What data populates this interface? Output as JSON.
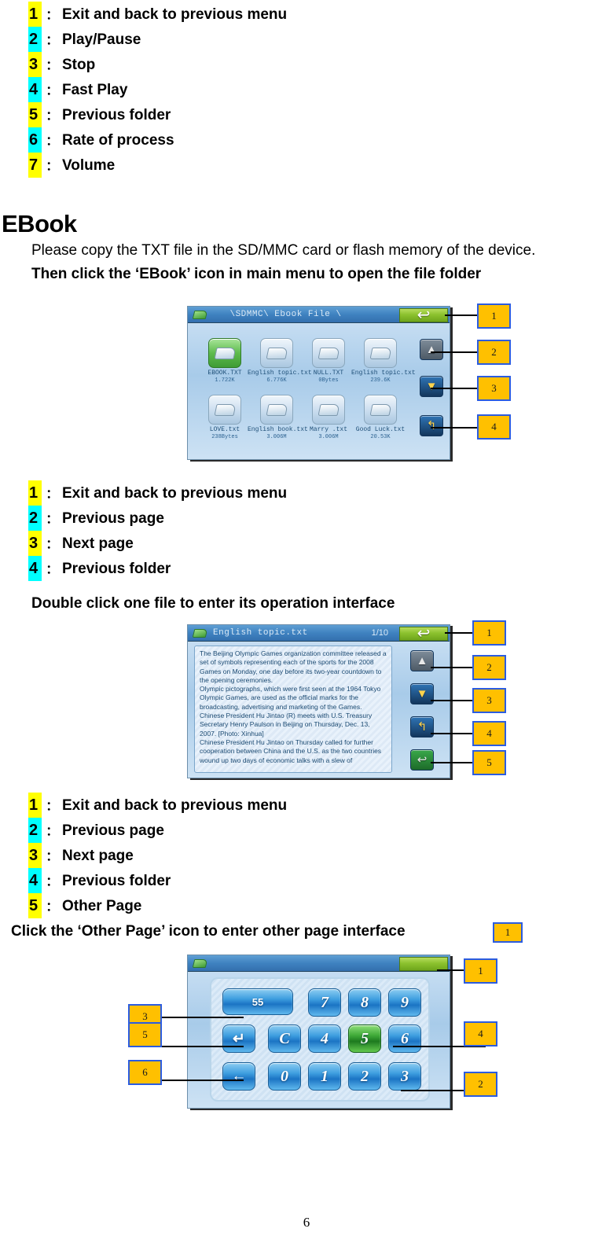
{
  "music_legend": [
    {
      "num": "1",
      "hl": "yellow",
      "label": "Exit and back to previous menu"
    },
    {
      "num": "2",
      "hl": "cyan",
      "label": "Play/Pause"
    },
    {
      "num": "3",
      "hl": "yellow",
      "label": "Stop"
    },
    {
      "num": "4",
      "hl": "cyan",
      "label": "Fast Play"
    },
    {
      "num": "5",
      "hl": "yellow",
      "label": "Previous folder"
    },
    {
      "num": "6",
      "hl": "cyan",
      "label": "Rate of process"
    },
    {
      "num": "7",
      "hl": "yellow",
      "label": "Volume"
    }
  ],
  "ebook": {
    "heading": "EBook",
    "intro": "Please copy the TXT file in the SD/MMC card or flash memory of the device.",
    "instruction": "Then click the ‘EBook’ icon in main menu to open the file folder"
  },
  "filebrowser": {
    "path": "\\SDMMC\\ Ebook File  \\",
    "back_glyph": "↩",
    "side_buttons": [
      {
        "name": "page-up",
        "glyph": "▲",
        "style": "grey"
      },
      {
        "name": "page-down",
        "glyph": "▼",
        "style": "blue"
      },
      {
        "name": "previous-folder",
        "glyph": "↰",
        "style": "blue"
      }
    ],
    "files": [
      {
        "name": "EBOOK.TXT",
        "size": "1.722K",
        "selected": true
      },
      {
        "name": "English topic.txt",
        "size": "6.776K",
        "selected": false
      },
      {
        "name": "NULL.TXT",
        "size": "0Bytes",
        "selected": false
      },
      {
        "name": "English topic.txt",
        "size": "239.6K",
        "selected": false
      },
      {
        "name": "LOVE.txt",
        "size": "238Bytes",
        "selected": false
      },
      {
        "name": "English book.txt",
        "size": "3.006M",
        "selected": false
      },
      {
        "name": "Marry .txt",
        "size": "3.006M",
        "selected": false
      },
      {
        "name": "Good Luck.txt",
        "size": "20.53K",
        "selected": false
      }
    ],
    "callouts": [
      "1",
      "2",
      "3",
      "4"
    ]
  },
  "filebrowser_legend": [
    {
      "num": "1",
      "hl": "yellow",
      "label": "Exit and back to previous menu"
    },
    {
      "num": "2",
      "hl": "cyan",
      "label": "Previous page"
    },
    {
      "num": "3",
      "hl": "yellow",
      "label": "Next page"
    },
    {
      "num": "4",
      "hl": "cyan",
      "label": "Previous folder"
    }
  ],
  "reader_instruction": "Double click one file to enter its operation interface",
  "reader": {
    "title": "English topic.txt",
    "page_indicator": "1/10",
    "back_glyph": "↩",
    "side_buttons": [
      {
        "name": "previous-page",
        "glyph": "▲",
        "style": "grey"
      },
      {
        "name": "next-page",
        "glyph": "▼",
        "style": "blue"
      },
      {
        "name": "previous-folder",
        "glyph": "↰",
        "style": "blue"
      },
      {
        "name": "other-page",
        "glyph": "↩",
        "style": "green"
      }
    ],
    "text_lines": [
      "The Beijing Olympic Games organization committee released a",
      "set of symbols representing each of the sports for the 2008",
      "Games on Monday, one day before its two-year countdown to",
      "the opening ceremonies.",
      "Olympic pictographs, which were first seen at the 1964 Tokyo",
      "Olympic Games, are used as the official marks for the",
      "broadcasting, advertising and marketing of the Games.",
      "Chinese President Hu Jintao (R) meets with U.S. Treasury",
      "Secretary Henry Paulson in Beijing on Thursday, Dec. 13,",
      "2007.  [Photo: Xinhua]",
      "Chinese President Hu Jintao on Thursday called for further",
      "cooperation between China and the U.S. as the two countries",
      "wound up two days of economic talks with a slew of"
    ],
    "callouts": [
      "1",
      "2",
      "3",
      "4",
      "5"
    ]
  },
  "reader_legend": [
    {
      "num": "1",
      "hl": "yellow",
      "label": "Exit and back to previous menu"
    },
    {
      "num": "2",
      "hl": "cyan",
      "label": "Previous page"
    },
    {
      "num": "3",
      "hl": "yellow",
      "label": "Next page"
    },
    {
      "num": "4",
      "hl": "cyan",
      "label": "Previous folder"
    },
    {
      "num": "5",
      "hl": "yellow",
      "label": "Other Page"
    }
  ],
  "otherpage_instruction": "Click the ‘Other Page’ icon to enter other page interface",
  "otherpage_inline_callout": "1",
  "keypad": {
    "display_value": "55",
    "keys": [
      {
        "label": "7",
        "type": "digit",
        "highlight": false
      },
      {
        "label": "8",
        "type": "digit",
        "highlight": false
      },
      {
        "label": "9",
        "type": "digit",
        "highlight": false
      },
      {
        "label": "↵",
        "type": "sym",
        "highlight": false
      },
      {
        "label": "C",
        "type": "digit",
        "highlight": false
      },
      {
        "label": "4",
        "type": "digit",
        "highlight": false
      },
      {
        "label": "5",
        "type": "digit",
        "highlight": true
      },
      {
        "label": "6",
        "type": "digit",
        "highlight": false
      },
      {
        "label": "←",
        "type": "sym",
        "highlight": false
      },
      {
        "label": "0",
        "type": "digit",
        "highlight": false
      },
      {
        "label": "1",
        "type": "digit",
        "highlight": false
      },
      {
        "label": "2",
        "type": "digit",
        "highlight": false
      },
      {
        "label": "3",
        "type": "digit",
        "highlight": false
      }
    ],
    "callouts_left": [
      "3",
      "5",
      "6"
    ],
    "callouts_right": [
      "1",
      "4",
      "2"
    ]
  },
  "footer": {
    "page_number": "6"
  }
}
